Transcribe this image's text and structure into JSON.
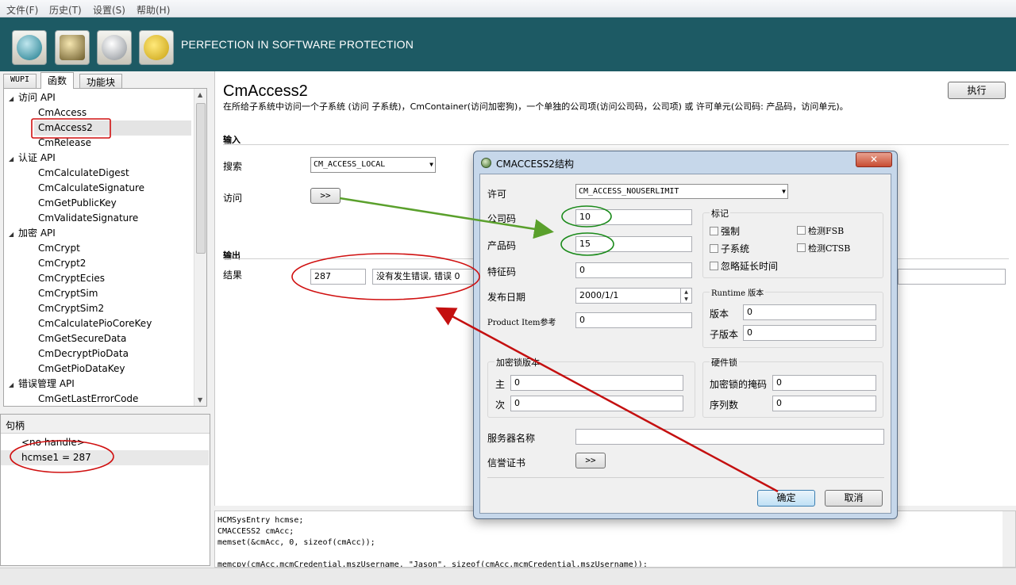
{
  "menu": [
    "文件(F)",
    "历史(T)",
    "设置(S)",
    "帮助(H)"
  ],
  "header": {
    "title": "PERFECTION IN SOFTWARE PROTECTION",
    "toolbar_icons": [
      "cm-logo-icon",
      "document-icon",
      "key-icon",
      "gear-icon"
    ]
  },
  "tabs": [
    "WUPI",
    "函数",
    "功能块"
  ],
  "tree": {
    "groups": [
      {
        "label": "访问 API",
        "items": [
          "CmAccess",
          "CmAccess2",
          "CmRelease"
        ]
      },
      {
        "label": "认证 API",
        "items": [
          "CmCalculateDigest",
          "CmCalculateSignature",
          "CmGetPublicKey",
          "CmValidateSignature"
        ]
      },
      {
        "label": "加密 API",
        "items": [
          "CmCrypt",
          "CmCrypt2",
          "CmCryptEcies",
          "CmCryptSim",
          "CmCryptSim2",
          "CmCalculatePioCoreKey",
          "CmGetSecureData",
          "CmDecryptPioData",
          "CmGetPioDataKey"
        ]
      },
      {
        "label": "错误管理 API",
        "items": [
          "CmGetLastErrorCode"
        ]
      }
    ],
    "selected": "CmAccess2"
  },
  "handles": {
    "header": "句柄",
    "items": [
      "<no handle>",
      "hcmse1 = 287"
    ]
  },
  "main": {
    "title": "CmAccess2",
    "description": "在所给子系统中访问一个子系统 (访问 子系统)，CmContainer(访问加密狗)，一个单独的公司项(访问公司码，公司项) 或 许可单元(公司码: 产品码，访问单元)。",
    "execute_button": "执行",
    "input_section": "输入",
    "search_label": "搜索",
    "search_value": "CM_ACCESS_LOCAL",
    "access_label": "访问",
    "access_button": ">>",
    "output_section": "输出",
    "result_label": "结果",
    "result_value": "287",
    "result_message": "没有发生错误, 错误 0"
  },
  "code_lines": [
    "HCMSysEntry hcmse;",
    "CMACCESS2 cmAcc;",
    "memset(&cmAcc, 0, sizeof(cmAcc));",
    "",
    "memcpy(cmAcc.mcmCredential.mszUsername, \"Jason\", sizeof(cmAcc.mcmCredential.mszUsername));"
  ],
  "dialog": {
    "title": "CMACCESS2结构",
    "close": "✕",
    "license_label": "许可",
    "license_value": "CM_ACCESS_NOUSERLIMIT",
    "firm_code_label": "公司码",
    "firm_code_value": "10",
    "product_code_label": "产品码",
    "product_code_value": "15",
    "feature_code_label": "特征码",
    "feature_code_value": "0",
    "release_date_label": "发布日期",
    "release_date_value": "2000/1/1",
    "product_item_label": "Product Item参考",
    "product_item_value": "0",
    "flags_group": "标记",
    "flags": [
      "强制",
      "检测FSB",
      "子系统",
      "检测CTSB",
      "忽略延长时间"
    ],
    "runtime_group": "Runtime 版本",
    "version_label": "版本",
    "version_value": "0",
    "subversion_label": "子版本",
    "subversion_value": "0",
    "dongle_group": "加密锁版本",
    "major_label": "主",
    "major_value": "0",
    "minor_label": "次",
    "minor_value": "0",
    "hardware_group": "硬件锁",
    "mask_label": "加密锁的掩码",
    "mask_value": "0",
    "serial_label": "序列数",
    "serial_value": "0",
    "server_label": "服务器名称",
    "server_value": "",
    "credential_label": "信誉证书",
    "credential_button": ">>",
    "ok_button": "确定",
    "cancel_button": "取消"
  },
  "colors": {
    "header_bg": "#1d5a64",
    "annotation_red": "#d01010",
    "annotation_green": "#1a8a1a",
    "arrow_green": "#5aa02c",
    "dialog_frame": "#c6d7ea"
  }
}
